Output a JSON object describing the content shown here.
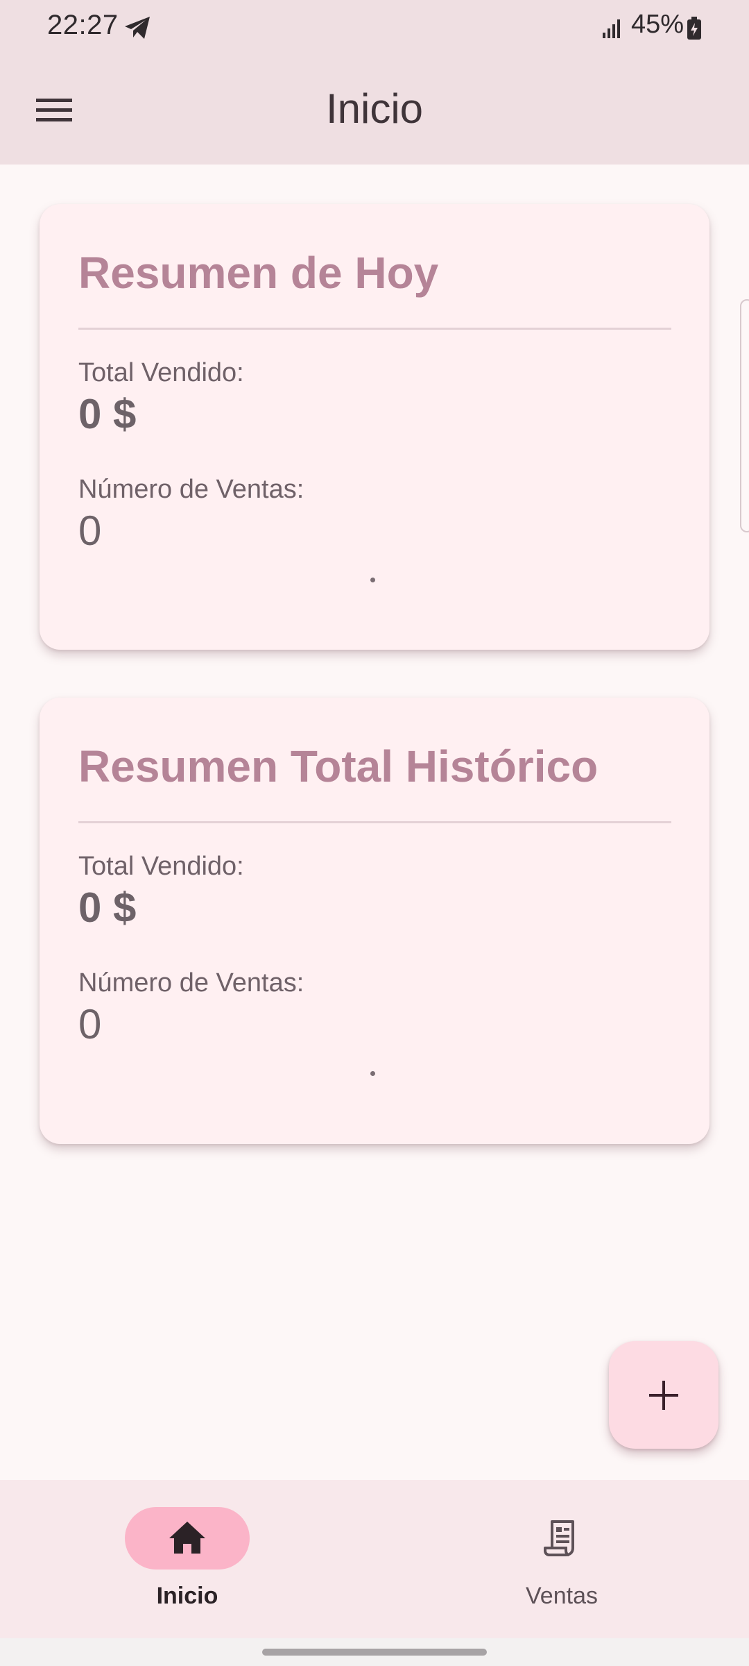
{
  "status_bar": {
    "time": "22:27",
    "battery": "45%",
    "icons": [
      "telegram-send-icon",
      "signal-icon",
      "battery-charging-icon"
    ]
  },
  "app_bar": {
    "title": "Inicio",
    "menu_icon": "menu-icon"
  },
  "cards": [
    {
      "title": "Resumen de Hoy",
      "total_label": "Total Vendido:",
      "total_value": "0 $",
      "count_label": "Número de Ventas:",
      "count_value": "0",
      "dot": "."
    },
    {
      "title": "Resumen Total Histórico",
      "total_label": "Total Vendido:",
      "total_value": "0 $",
      "count_label": "Número de Ventas:",
      "count_value": "0",
      "dot": "."
    }
  ],
  "fab": {
    "icon": "plus-icon"
  },
  "bottom_nav": {
    "items": [
      {
        "label": "Inicio",
        "icon": "home-icon",
        "active": true
      },
      {
        "label": "Ventas",
        "icon": "receipt-icon",
        "active": false
      }
    ]
  },
  "colors": {
    "app_bar_bg": "#efdfe2",
    "background": "#fdf7f7",
    "card_bg": "#fff0f2",
    "card_title": "#b58497",
    "fab_bg": "#fddbe3",
    "nav_bg": "#f8e8eb",
    "nav_active_pill": "#fbb4c8"
  }
}
